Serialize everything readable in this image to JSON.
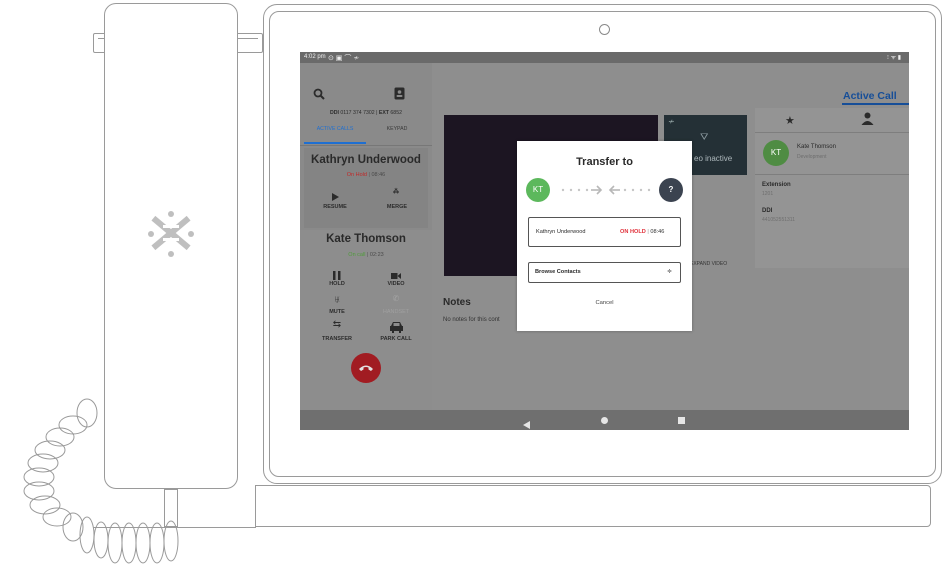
{
  "status_bar": {
    "time": "4:02 pm",
    "icons_left": "⊙ ▣ ⌒ ≁",
    "icons_right": "⁝ ᯤ ▮"
  },
  "sidebar": {
    "ddi_label": "DDI",
    "ddi_number": "0117 374 7302",
    "ext_label": "EXT",
    "ext_number": "6852",
    "tabs": [
      {
        "label": "ACTIVE CALLS"
      },
      {
        "label": "KEYPAD"
      }
    ],
    "held_call": {
      "name": "Kathryn Underwood",
      "status": "On Hold",
      "duration": "08:46",
      "actions": [
        {
          "label": "RESUME"
        },
        {
          "label": "MERGE"
        }
      ]
    },
    "active_call": {
      "name": "Kate Thomson",
      "status": "On call",
      "duration": "02:23",
      "actions": [
        {
          "label": "HOLD"
        },
        {
          "label": "VIDEO"
        },
        {
          "label": "MUTE"
        },
        {
          "label": "HANDSET"
        },
        {
          "label": "TRANSFER"
        },
        {
          "label": "PARK CALL"
        }
      ]
    }
  },
  "main": {
    "header_title": "Active Call",
    "video_label": "eo inactive",
    "expand_video": "EXPAND VIDEO",
    "notes_title": "Notes",
    "notes_empty": "No notes for this cont"
  },
  "contact": {
    "initials": "KT",
    "name": "Kate Thomson",
    "department": "Development",
    "extension_label": "Extension",
    "extension_value": "1201",
    "ddi_label": "DDI",
    "ddi_value": "441052551311"
  },
  "modal": {
    "title": "Transfer to",
    "from_initials": "KT",
    "to_symbol": "?",
    "held_name": "Kathryn Underwood",
    "held_status": "ON HOLD",
    "held_duration": "08:46",
    "browse_label": "Browse Contacts",
    "browse_arrow": "≑",
    "cancel_label": "Cancel"
  },
  "colors": {
    "green": "#5cb85c",
    "red": "#e0303a",
    "blue": "#1f6fd1",
    "dark": "#3b4350"
  },
  "icons": [
    "search-icon",
    "contacts-icon",
    "play-icon",
    "merge-icon",
    "pause-icon",
    "video-icon",
    "mute-icon",
    "handset-icon",
    "transfer-icon",
    "car-icon",
    "hangup-icon",
    "star-icon",
    "person-icon",
    "back-icon",
    "home-icon",
    "recents-icon"
  ]
}
